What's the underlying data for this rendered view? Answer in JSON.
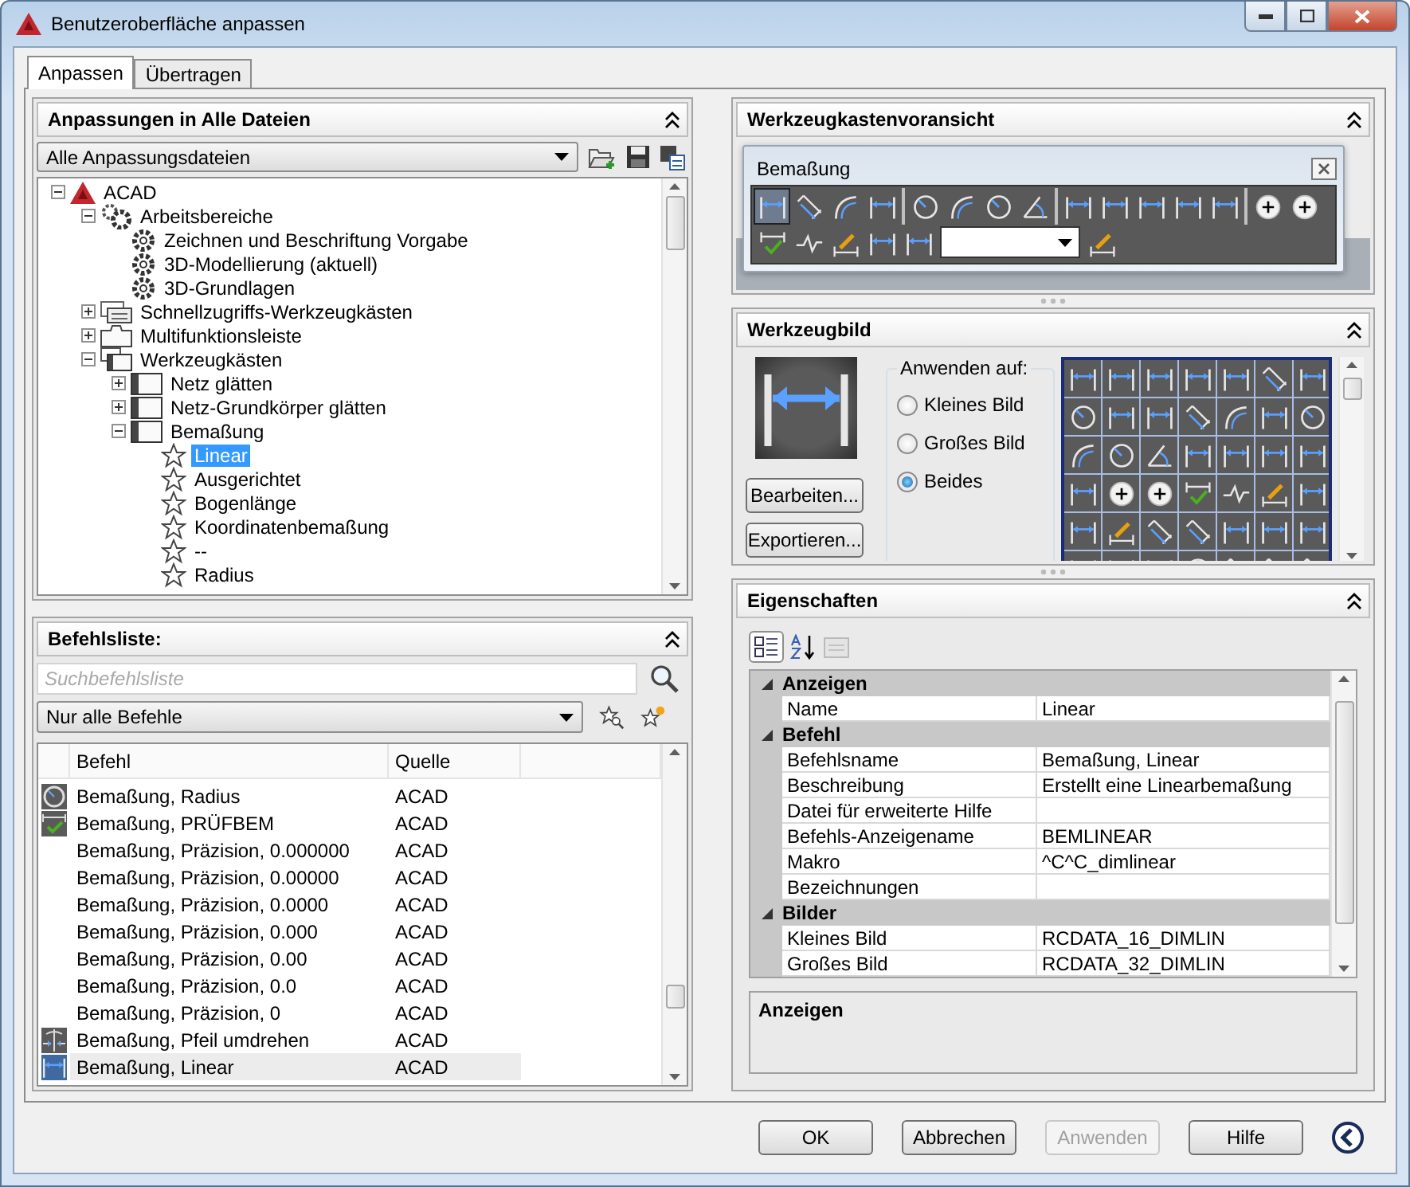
{
  "window": {
    "title": "Benutzeroberfläche anpassen"
  },
  "tabs": [
    {
      "label": "Anpassen",
      "selected": true
    },
    {
      "label": "Übertragen",
      "selected": false
    }
  ],
  "customizations": {
    "title": "Anpassungen in Alle Dateien",
    "file_filter": "Alle Anpassungsdateien",
    "tree": [
      {
        "label": "ACAD",
        "kind": "logo",
        "expanded": true,
        "selected": false,
        "children": [
          {
            "label": "Arbeitsbereiche",
            "kind": "workspaces",
            "expanded": true,
            "selected": false,
            "children": [
              {
                "label": "Zeichnen und Beschriftung Vorgabe",
                "kind": "workspace",
                "selected": false
              },
              {
                "label": "3D-Modellierung (aktuell)",
                "kind": "workspace",
                "selected": false
              },
              {
                "label": "3D-Grundlagen",
                "kind": "workspace",
                "selected": false
              }
            ]
          },
          {
            "label": "Schnellzugriffs-Werkzeugkästen",
            "kind": "quick-access",
            "expanded": false,
            "selected": false
          },
          {
            "label": "Multifunktionsleiste",
            "kind": "ribbon",
            "expanded": false,
            "selected": false
          },
          {
            "label": "Werkzeugkästen",
            "kind": "toolbars",
            "expanded": true,
            "selected": false,
            "children": [
              {
                "label": "Netz glätten",
                "kind": "toolbar",
                "expanded": false,
                "selected": false
              },
              {
                "label": "Netz-Grundkörper glätten",
                "kind": "toolbar",
                "expanded": false,
                "selected": false
              },
              {
                "label": "Bemaßung",
                "kind": "toolbar",
                "expanded": true,
                "selected": false,
                "children": [
                  {
                    "label": "Linear",
                    "kind": "command",
                    "selected": true
                  },
                  {
                    "label": "Ausgerichtet",
                    "kind": "command",
                    "selected": false
                  },
                  {
                    "label": "Bogenlänge",
                    "kind": "command",
                    "selected": false
                  },
                  {
                    "label": "Koordinatenbemaßung",
                    "kind": "command",
                    "selected": false
                  },
                  {
                    "label": "--",
                    "kind": "command",
                    "selected": false
                  },
                  {
                    "label": "Radius",
                    "kind": "command",
                    "selected": false
                  }
                ]
              }
            ]
          }
        ]
      }
    ]
  },
  "command_list": {
    "title": "Befehlsliste:",
    "search": {
      "placeholder": "Suchbefehlsliste"
    },
    "filter": "Nur alle Befehle",
    "columns": [
      "Befehl",
      "Quelle"
    ],
    "rows": [
      {
        "kind": "radius",
        "command": "Bemaßung, Radius",
        "source": "ACAD",
        "selected": false
      },
      {
        "kind": "check",
        "command": "Bemaßung, PRÜFBEM",
        "source": "ACAD",
        "selected": false
      },
      {
        "kind": "plain",
        "command": "Bemaßung, Präzision, 0.000000",
        "source": "ACAD",
        "selected": false
      },
      {
        "kind": "plain",
        "command": "Bemaßung, Präzision, 0.00000",
        "source": "ACAD",
        "selected": false
      },
      {
        "kind": "plain",
        "command": "Bemaßung, Präzision, 0.0000",
        "source": "ACAD",
        "selected": false
      },
      {
        "kind": "plain",
        "command": "Bemaßung, Präzision, 0.000",
        "source": "ACAD",
        "selected": false
      },
      {
        "kind": "plain",
        "command": "Bemaßung, Präzision, 0.00",
        "source": "ACAD",
        "selected": false
      },
      {
        "kind": "plain",
        "command": "Bemaßung, Präzision, 0.0",
        "source": "ACAD",
        "selected": false
      },
      {
        "kind": "plain",
        "command": "Bemaßung, Präzision, 0",
        "source": "ACAD",
        "selected": false
      },
      {
        "kind": "flip",
        "command": "Bemaßung, Pfeil umdrehen",
        "source": "ACAD",
        "selected": false
      },
      {
        "kind": "linear",
        "command": "Bemaßung, Linear",
        "source": "ACAD",
        "selected": true
      }
    ]
  },
  "toolbar_preview": {
    "title": "Werkzeugkastenvoransicht",
    "toolbar_name": "Bemaßung"
  },
  "button_image": {
    "title": "Werkzeugbild",
    "buttons": [
      "Bearbeiten...",
      "Exportieren..."
    ],
    "apply_to": "Anwenden auf:",
    "options": [
      {
        "label": "Kleines Bild",
        "selected": false
      },
      {
        "label": "Großes Bild",
        "selected": false
      },
      {
        "label": "Beides",
        "selected": true
      }
    ]
  },
  "properties": {
    "title": "Eigenschaften",
    "groups": [
      {
        "name": "Anzeigen",
        "expanded": true,
        "rows": [
          {
            "name": "Name",
            "value": "Linear"
          }
        ]
      },
      {
        "name": "Befehl",
        "expanded": true,
        "rows": [
          {
            "name": "Befehlsname",
            "value": "Bemaßung, Linear"
          },
          {
            "name": "Beschreibung",
            "value": "Erstellt eine Linearbemaßung"
          },
          {
            "name": "Datei für erweiterte Hilfe",
            "value": ""
          },
          {
            "name": "Befehls-Anzeigename",
            "value": "BEMLINEAR"
          },
          {
            "name": "Makro",
            "value": "^C^C_dimlinear"
          },
          {
            "name": "Bezeichnungen",
            "value": ""
          }
        ]
      },
      {
        "name": "Bilder",
        "expanded": true,
        "rows": [
          {
            "name": "Kleines Bild",
            "value": "RCDATA_16_DIMLIN"
          },
          {
            "name": "Großes Bild",
            "value": "RCDATA_32_DIMLIN"
          }
        ]
      }
    ],
    "description_title": "Anzeigen"
  },
  "footer_buttons": [
    {
      "label": "OK",
      "disabled": false
    },
    {
      "label": "Abbrechen",
      "disabled": false
    },
    {
      "label": "Anwenden",
      "disabled": true
    },
    {
      "label": "Hilfe",
      "disabled": false
    }
  ]
}
